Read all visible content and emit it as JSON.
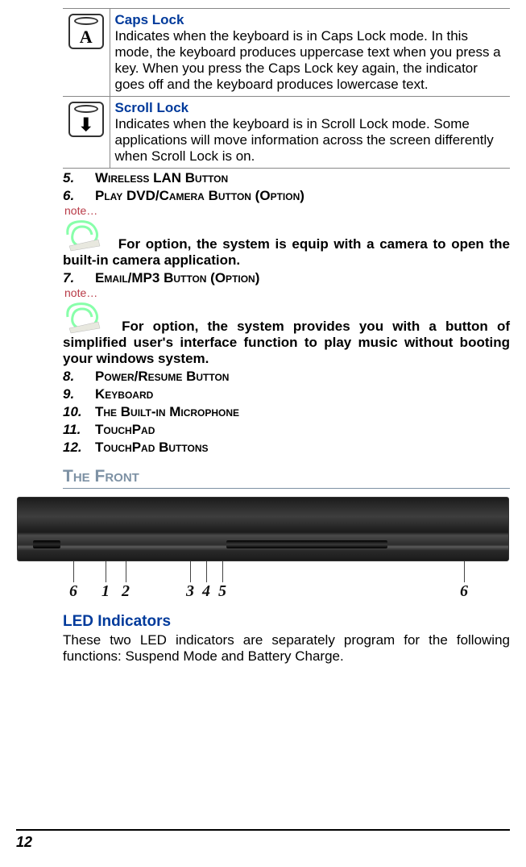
{
  "indicators": [
    {
      "title": "Caps Lock",
      "desc": "Indicates when the keyboard is in Caps Lock mode.  In this mode, the keyboard produces uppercase text when you press a key.  When you press the Caps Lock key again, the indicator goes off and the keyboard produces lowercase text.",
      "glyph": "A"
    },
    {
      "title": "Scroll Lock",
      "desc": "Indicates when the keyboard is in Scroll Lock mode.  Some applications will move information across the screen differently when Scroll Lock is on.",
      "glyph": "⬇"
    }
  ],
  "items_a": [
    {
      "num": "5.",
      "label": "Wireless LAN Button"
    },
    {
      "num": "6.",
      "label": "Play DVD/Camera Button (Option)"
    }
  ],
  "note1": "For option, the system is equip with a camera to open the built-in camera application.",
  "items_b": [
    {
      "num": "7.",
      "label": "Email/MP3 Button (Option)"
    }
  ],
  "note2": "For option, the system provides you with a button of simplified user's interface function to play music without booting your windows system.",
  "items_c": [
    {
      "num": "8.",
      "label": "Power/Resume Button"
    },
    {
      "num": "9.",
      "label": "Keyboard"
    },
    {
      "num": "10.",
      "label": "The Built-in Microphone"
    },
    {
      "num": "11.",
      "label": "TouchPad"
    },
    {
      "num": "12.",
      "label": "TouchPad Buttons"
    }
  ],
  "section_front": "The Front",
  "front_labels": [
    "6",
    "1",
    "2",
    "3",
    "4",
    "5",
    "6"
  ],
  "led_heading": "LED Indicators",
  "led_para": "These two LED indicators are separately program for the following functions: Suspend Mode and Battery Charge.",
  "note_word": "note…",
  "page_number": "12"
}
